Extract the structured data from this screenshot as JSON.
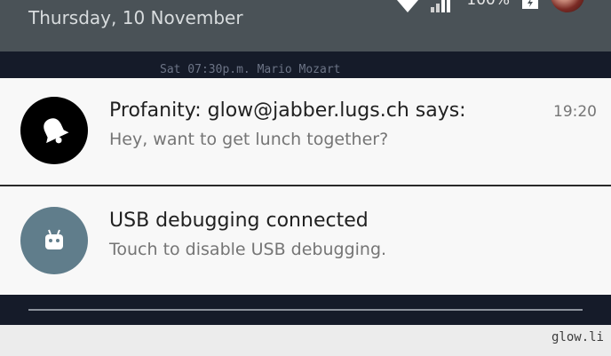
{
  "shade": {
    "date": "Thursday, 10 November",
    "battery_percent": "100%",
    "icons": [
      "wifi-icon",
      "signal-icon",
      "battery-icon",
      "avatar"
    ]
  },
  "background_terminal": {
    "text": "Sat 07:30p.m. Mario Mozart"
  },
  "notifications": [
    {
      "icon": "bell-icon",
      "title": "Profanity: glow@jabber.lugs.ch says:",
      "text": "Hey, want to get lunch together?",
      "time": "19:20",
      "icon_color": "#000000"
    },
    {
      "icon": "android-icon",
      "title": "USB debugging connected",
      "text": "Touch to disable USB debugging.",
      "icon_color": "#607d8b"
    }
  ],
  "footer": {
    "watermark": "glow.li"
  },
  "colors": {
    "shade_header": "#4a5257",
    "card_background": "#f8f8f8",
    "terminal_background": "#151b29"
  }
}
